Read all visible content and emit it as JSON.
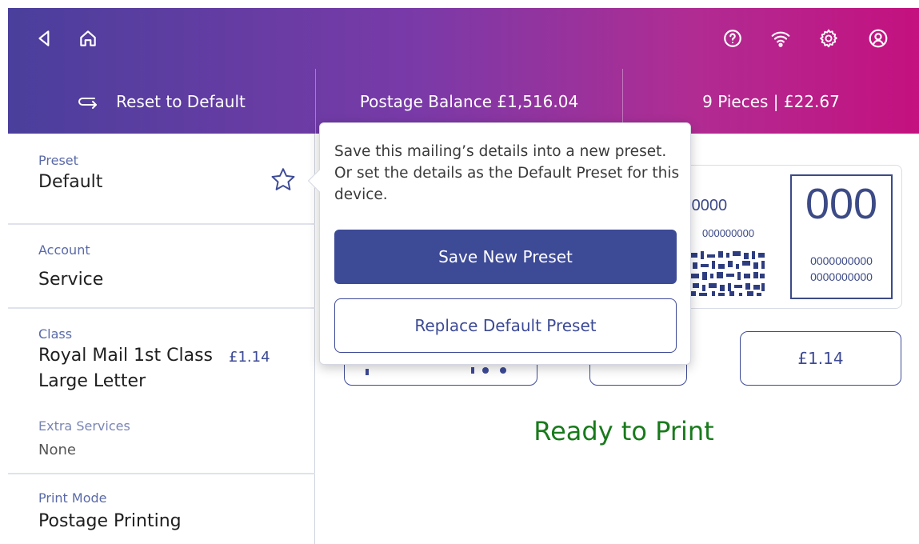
{
  "topbar": {
    "icons": [
      "back-icon",
      "home-icon",
      "help-icon",
      "wifi-icon",
      "settings-icon",
      "account-icon"
    ]
  },
  "tabs": {
    "reset_label": "Reset to Default",
    "balance_label": "Postage Balance £1,516.04",
    "pieces_label": "9 Pieces | £22.67"
  },
  "sidebar": {
    "preset": {
      "label": "Preset",
      "value": "Default"
    },
    "account": {
      "label": "Account",
      "value": "Service"
    },
    "class": {
      "label": "Class",
      "value_line1": "Royal Mail 1st Class",
      "value_line2": "Large Letter",
      "price": "£1.14"
    },
    "extra_services": {
      "label": "Extra Services",
      "value": "None"
    },
    "print_mode": {
      "label": "Print Mode",
      "value": "Postage Printing"
    }
  },
  "stamp": {
    "partial_number": ")0000",
    "partial_small": "000000000",
    "box_big": "000",
    "box_line1": "0000000000",
    "box_line2": "0000000000"
  },
  "value_buttons": {
    "price_label": "£1.14"
  },
  "status": {
    "ready_text": "Ready to Print"
  },
  "popover": {
    "message": "Save this mailing’s details into a new preset. Or set the details as the Default Preset for this device.",
    "save_new_label": "Save New Preset",
    "replace_default_label": "Replace Default Preset"
  },
  "colors": {
    "brand_primary": "#3d4a96",
    "gradient_start": "#4a3f9c",
    "gradient_end": "#c4117f",
    "ready_green": "#197a1c"
  }
}
